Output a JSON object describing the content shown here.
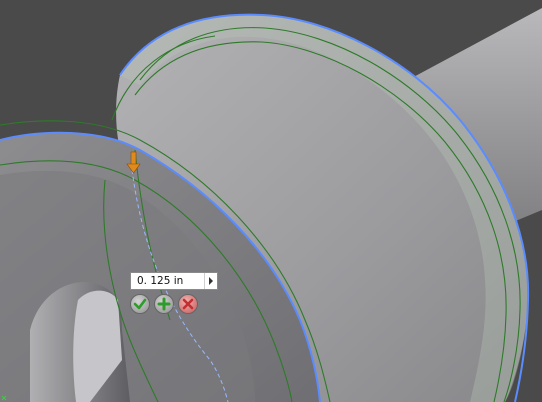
{
  "dimension": {
    "value": "0. 125 in"
  },
  "colors": {
    "background": "#4a4a4a",
    "model_face": "#9a9a9c",
    "highlight_edge": "#5b8cff",
    "edge_green": "#2f7a2a",
    "manipulator": "#e08a1e",
    "ok_check": "#2e9b2a",
    "apply_plus": "#2e9b2a",
    "cancel_x": "#c23030"
  },
  "icons": {
    "ok": "check-icon",
    "apply": "plus-icon",
    "cancel": "x-icon",
    "dropdown": "triangle-right-icon",
    "manipulator": "arrow-manipulator-icon"
  }
}
